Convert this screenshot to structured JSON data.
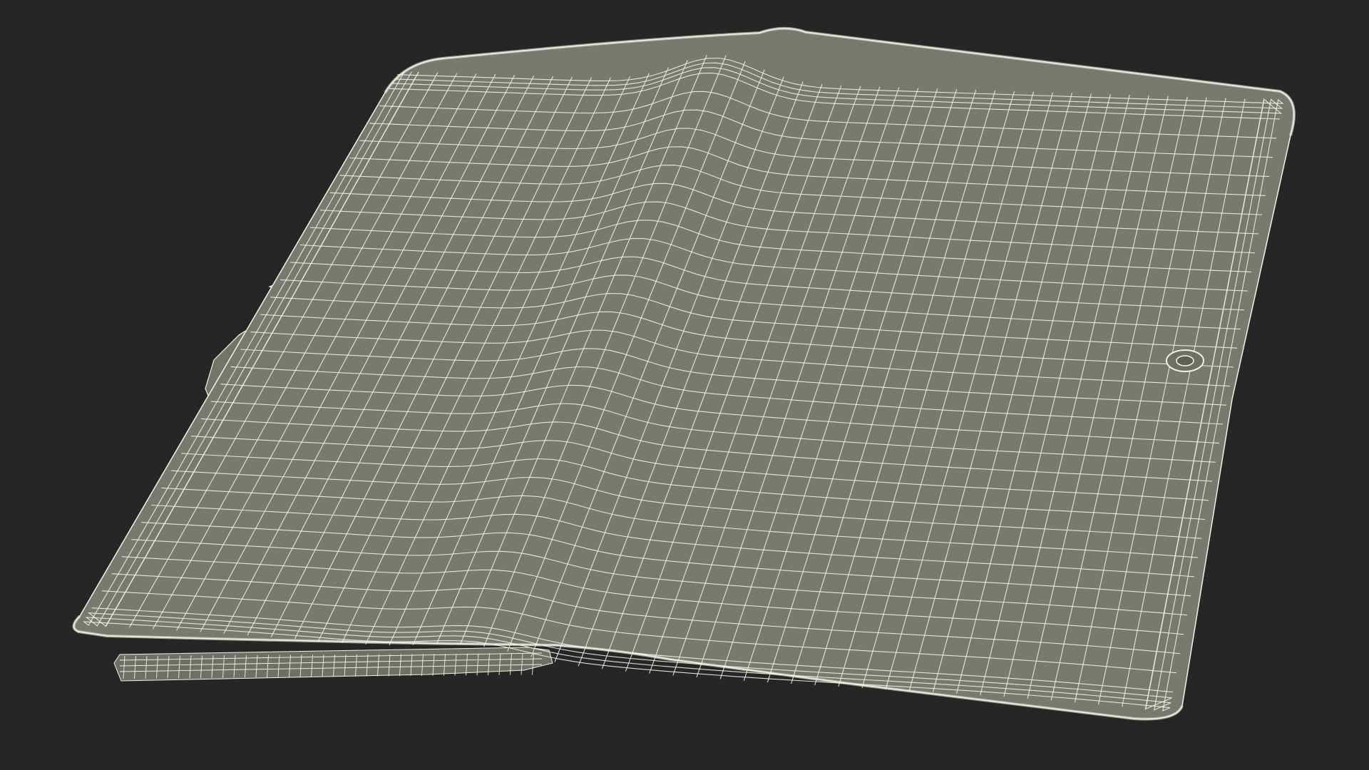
{
  "scene": {
    "subject": "wallet-wireframe-render",
    "background_color": "#262626",
    "surface_color": "#787A6F",
    "surface_shade_color": "#6E7065",
    "wire_color": "#F4F2E6",
    "edge_color": "#5E6056"
  }
}
